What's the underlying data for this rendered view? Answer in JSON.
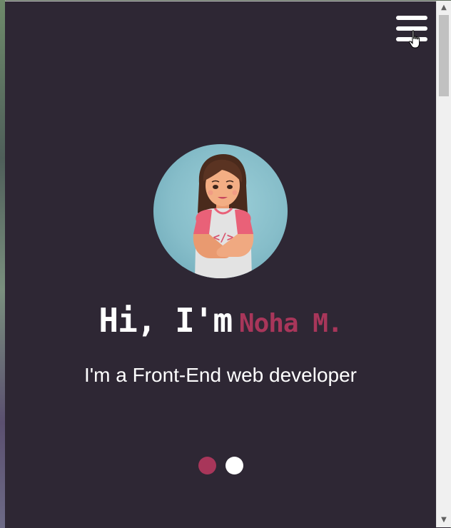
{
  "hero": {
    "greeting": "Hi, I'm",
    "name": "Noha M.",
    "subtitle": "I'm a Front-End web developer"
  },
  "avatar": {
    "shirt_text": "</>"
  },
  "menu": {
    "icon": "hamburger-menu-icon"
  },
  "carousel": {
    "slide_count": 2,
    "active_index": 0
  },
  "scrollbar": {
    "up_arrow": "▲",
    "down_arrow": "▼"
  },
  "colors": {
    "background": "#2e2734",
    "accent": "#a8365a",
    "text": "#ffffff"
  }
}
